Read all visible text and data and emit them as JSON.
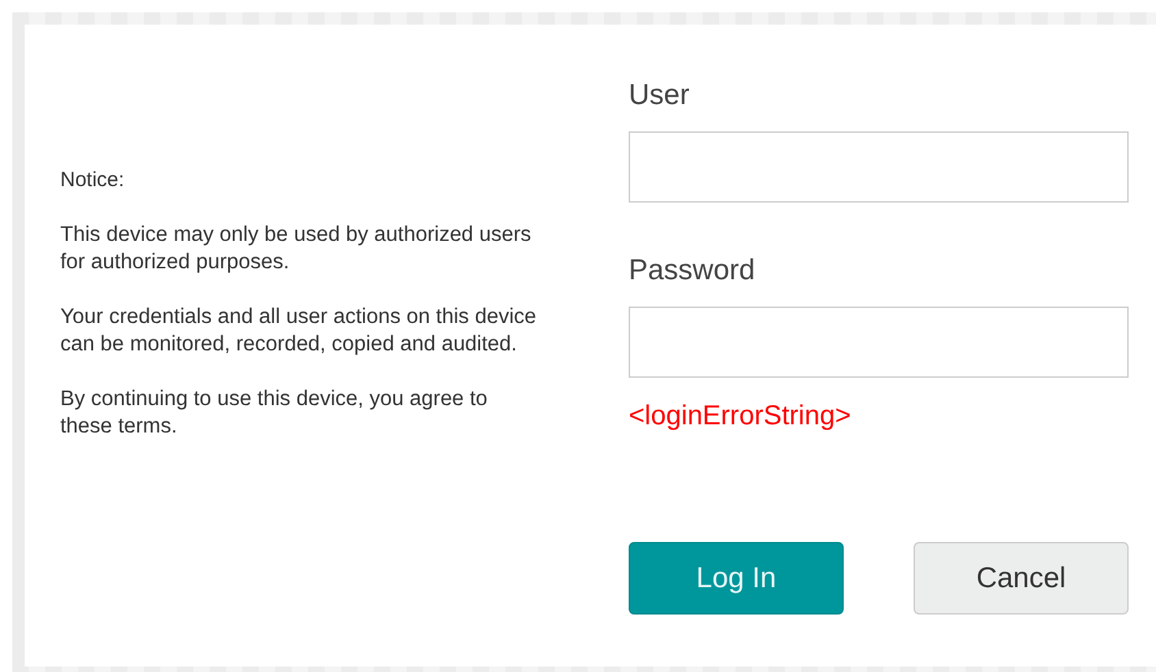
{
  "notice": {
    "title": "Notice:",
    "paragraphs": [
      "This device may only be used by authorized users for authorized purposes.",
      "Your credentials and all user actions on this device can be monitored, recorded, copied and audited.",
      "By continuing to use this device, you agree to these terms."
    ]
  },
  "fields": [
    {
      "label": "User"
    },
    {
      "label": "Password"
    }
  ],
  "error": "<loginErrorString>",
  "buttons": [
    {
      "label": "Log In",
      "kind": "primary"
    },
    {
      "label": "Cancel",
      "kind": "secondary"
    }
  ]
}
